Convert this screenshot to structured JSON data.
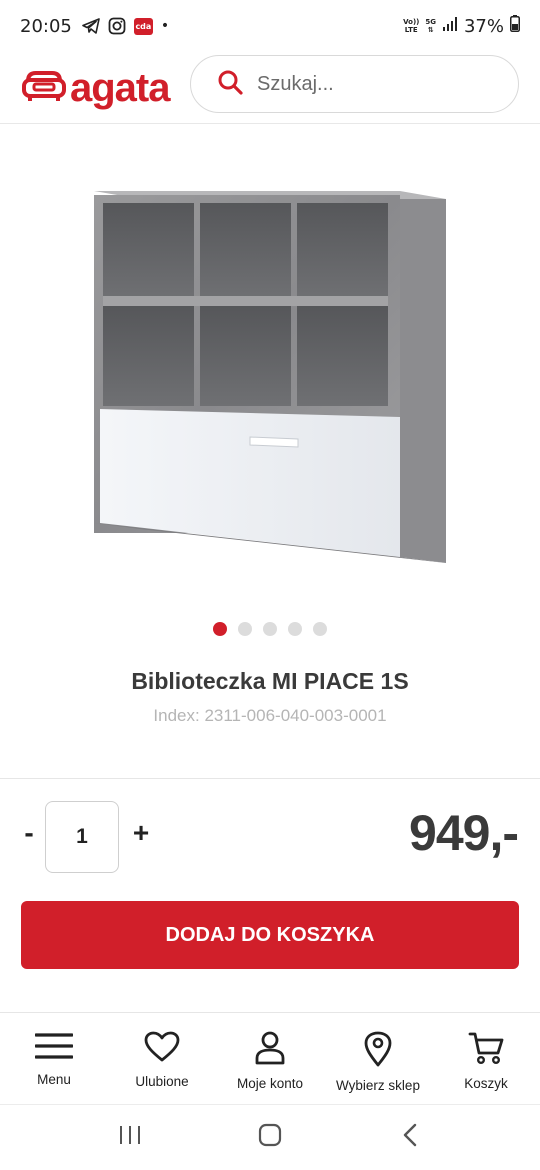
{
  "status_bar": {
    "time": "20:05",
    "cda_label": "cda",
    "battery": "37%",
    "volte": "Vo)) LTE",
    "network": "5G"
  },
  "header": {
    "logo_text": "agata",
    "search_placeholder": "Szukaj..."
  },
  "carousel": {
    "total": 5,
    "active_index": 0
  },
  "product": {
    "title": "Biblioteczka MI PIACE 1S",
    "index": "Index: 2311-006-040-003-0001"
  },
  "purchase": {
    "minus_label": "-",
    "quantity": "1",
    "plus_label": "+",
    "price": "949,-",
    "add_to_cart": "DODAJ DO KOSZYKA"
  },
  "bottom_nav": {
    "items": [
      {
        "label": "Menu",
        "icon": "menu-icon"
      },
      {
        "label": "Ulubione",
        "icon": "heart-icon"
      },
      {
        "label": "Moje konto",
        "icon": "user-icon"
      },
      {
        "label": "Wybierz sklep",
        "icon": "location-pin-icon"
      },
      {
        "label": "Koszyk",
        "icon": "cart-icon"
      }
    ]
  },
  "colors": {
    "brand": "#d11f2a",
    "text_dark": "#3a3a3a",
    "text_muted": "#b5b5b5"
  }
}
